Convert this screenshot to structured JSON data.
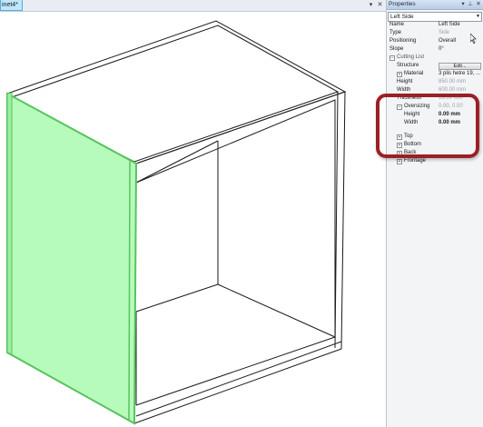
{
  "viewport": {
    "tab_label": "inet4*",
    "dropdown_icon": "chevron-down-icon",
    "close_icon": "close-icon",
    "selected_face_color": "#b7fbbc",
    "selected_edge_color": "#58c35e",
    "line_color": "#1a1a1a"
  },
  "properties": {
    "title": "Properties",
    "selected_object": "Left Side",
    "rows": [
      {
        "name": "Name",
        "value": "Left Side"
      },
      {
        "name": "Type",
        "value": "Side",
        "dim": true
      },
      {
        "name": "Positioning",
        "value": "Overall"
      },
      {
        "name": "Slope",
        "value": "0°"
      }
    ],
    "cutting_list": {
      "label": "Cutting List",
      "structure_label": "Structure",
      "structure_button": "Edit...",
      "material_label": "Material",
      "material_value": "3 plis hetre 19, ...",
      "height_label": "Height",
      "height_value": "850.00 mm",
      "width_label": "Width",
      "width_value": "600.00 mm",
      "thickness_label": "Thickness",
      "thickness_value": "19.00 mm",
      "oversizing_label": "Oversizing",
      "oversizing_value": "0.00, 0.00",
      "ov_height_label": "Height",
      "ov_height_value": "0.00 mm",
      "ov_width_label": "Width",
      "ov_width_value": "0.00 mm"
    },
    "sections": [
      "Top",
      "Bottom",
      "Back",
      "Frontage"
    ]
  },
  "colors": {
    "annotation_ring": "#9a2025",
    "panel_bg": "#f3f4f6"
  }
}
